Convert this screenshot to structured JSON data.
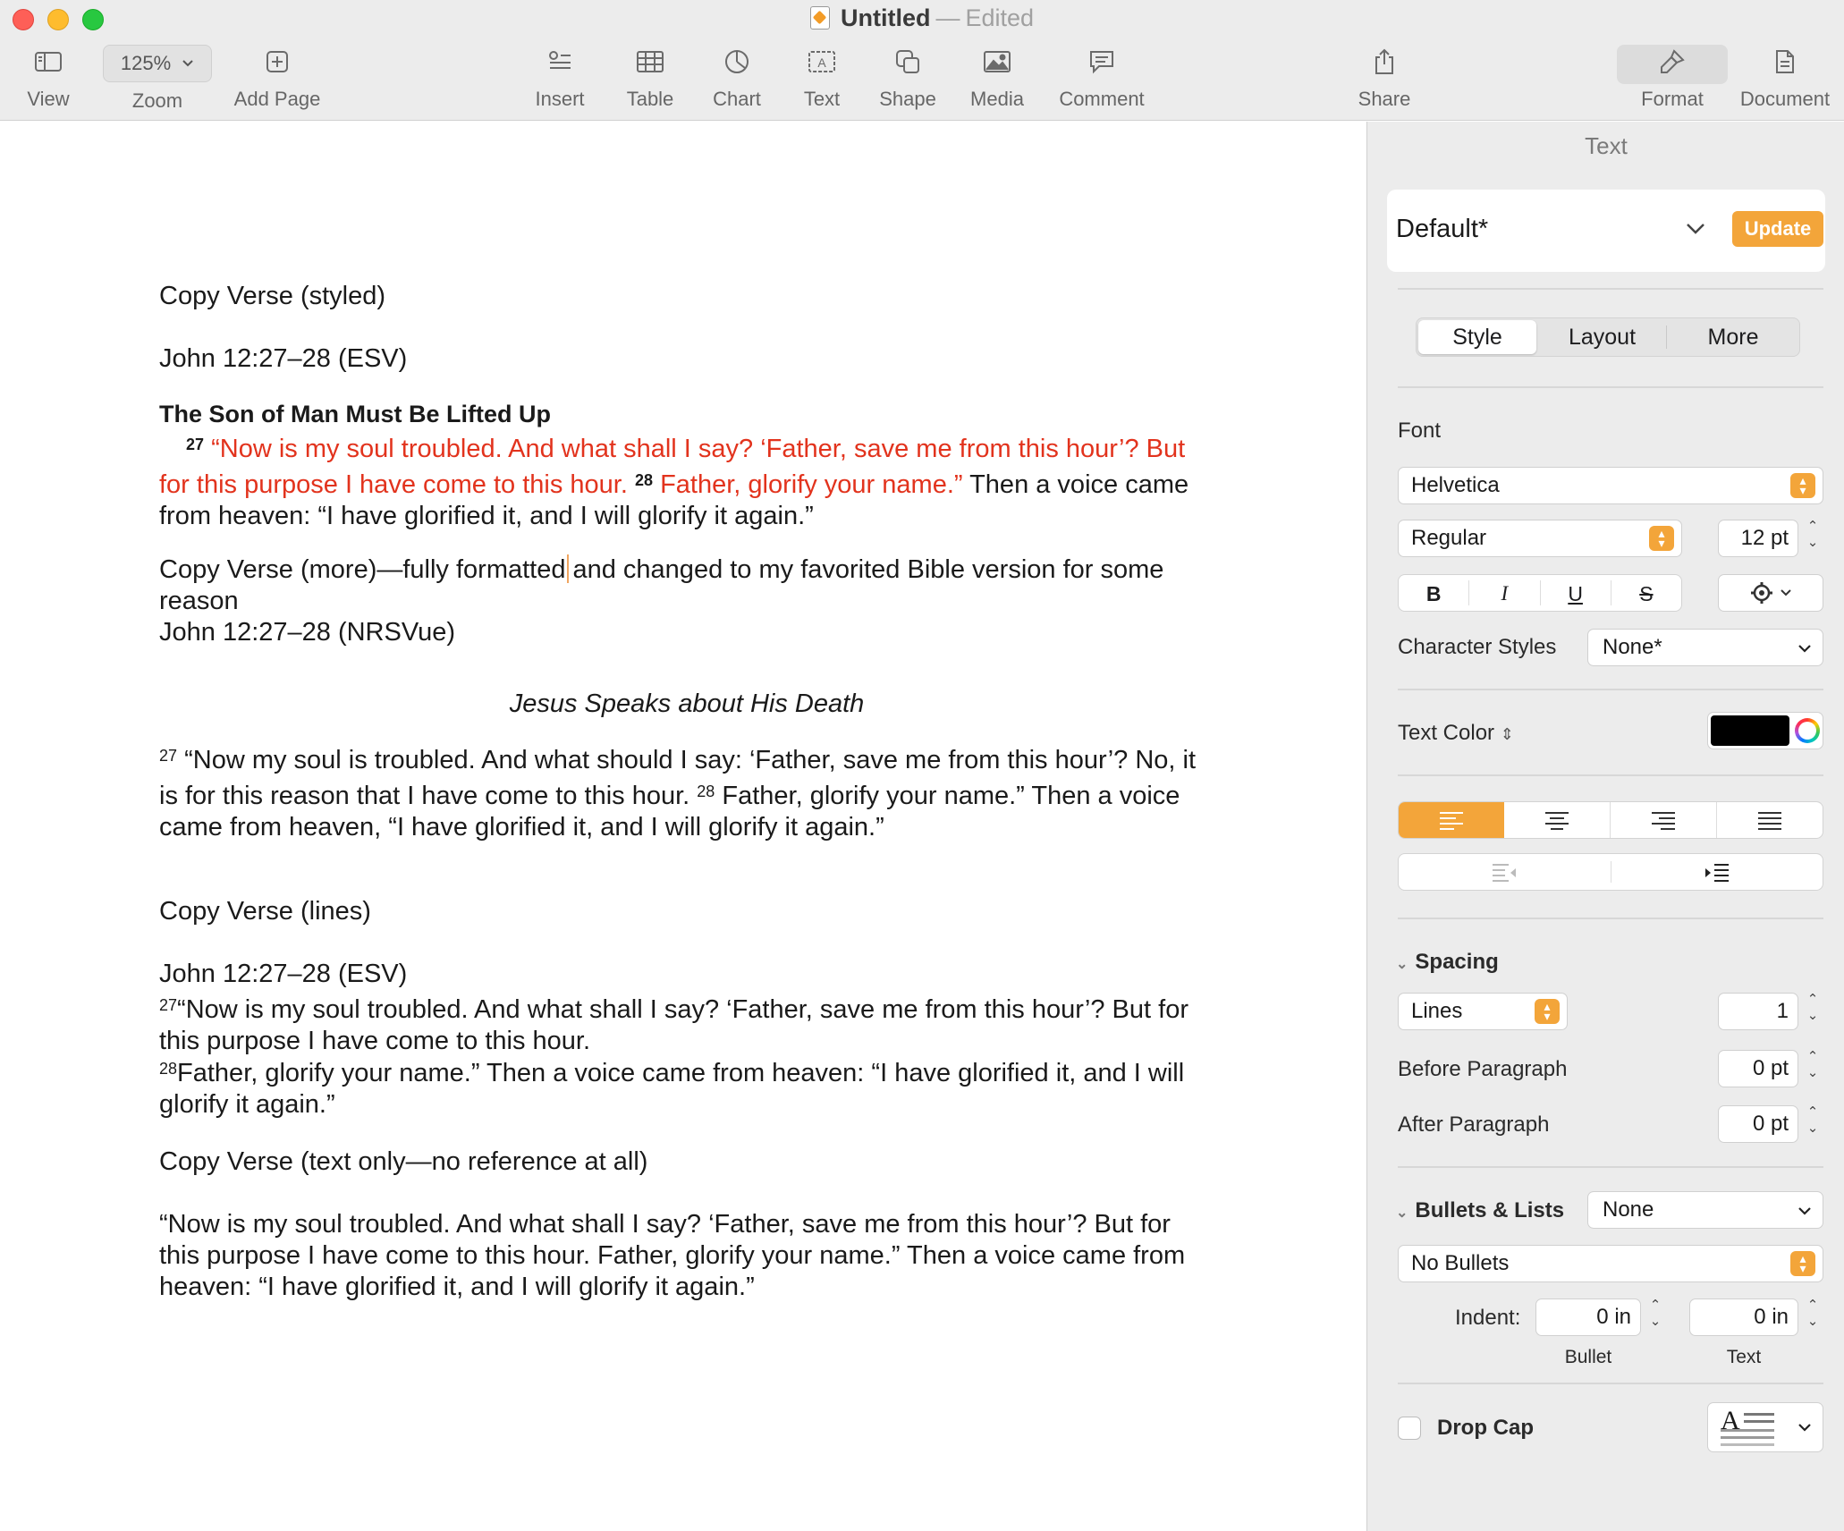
{
  "window": {
    "title": "Untitled",
    "separator": "—",
    "status": "Edited"
  },
  "toolbar": {
    "view": "View",
    "zoom_value": "125%",
    "zoom": "Zoom",
    "add_page": "Add Page",
    "insert": "Insert",
    "table": "Table",
    "chart": "Chart",
    "text": "Text",
    "shape": "Shape",
    "media": "Media",
    "comment": "Comment",
    "share": "Share",
    "format": "Format",
    "document": "Document"
  },
  "document": {
    "p1": "Copy Verse (styled)",
    "p2": "John 12:27–28 (ESV)",
    "p3_heading": "The Son of Man Must Be Lifted Up",
    "p4_sup27": "27",
    "p4_red1": "“Now is my soul troubled. And what shall I say? ‘Father, save me from this hour’? But for this purpose I have come to this hour.",
    "p4_sup28": "28",
    "p4_red2": "Father, glorify your name.”",
    "p4_black": "Then a voice came from heaven: “I have glorified it, and I will glorify it again.”",
    "p5_before_caret": "Copy Verse (more)—fully formatted",
    "p5_after_caret": "and changed to my favorited Bible version for some reason",
    "p6": "John 12:27–28 (NRSVue)",
    "p7_italic_heading": "Jesus Speaks about His Death",
    "p8_sup27": "27",
    "p8_text1": "“Now my soul is troubled. And what should I say: ‘Father, save me from this hour’? No, it is for this reason that I have come to this hour.",
    "p8_sup28": "28",
    "p8_text2": "Father, glorify your name.” Then a voice came from heaven, “I have glorified it, and I will glorify it again.”",
    "p9": "Copy Verse (lines)",
    "p10": "John 12:27–28 (ESV)",
    "p11_sup27": "27",
    "p11_text": "“Now is my soul troubled. And what shall I say? ‘Father, save me from this hour’? But for this purpose I have come to this hour.",
    "p12_sup28": "28",
    "p12_text": "Father, glorify your name.” Then a voice came from heaven: “I have glorified it, and I will glorify it again.”",
    "p13": "Copy Verse (text only—no reference at all)",
    "p14": "“Now is my soul troubled. And what shall I say? ‘Father, save me from this hour’? But for this purpose I have come to this hour. Father, glorify your name.” Then a voice came from heaven: “I have glorified it, and I will glorify it again.”"
  },
  "inspector": {
    "header": "Text",
    "paragraph_style": "Default*",
    "update_button": "Update",
    "tabs": [
      "Style",
      "Layout",
      "More"
    ],
    "active_tab": "Style",
    "font_label": "Font",
    "font_family": "Helvetica",
    "font_weight": "Regular",
    "font_size": "12 pt",
    "bold": "B",
    "italic": "I",
    "underline": "U",
    "strikethrough": "S",
    "character_styles_label": "Character Styles",
    "character_styles_value": "None*",
    "text_color_label": "Text Color",
    "text_color": "#000000",
    "alignment_active": "left",
    "spacing_label": "Spacing",
    "spacing_mode": "Lines",
    "spacing_value": "1",
    "before_paragraph_label": "Before Paragraph",
    "before_paragraph_value": "0 pt",
    "after_paragraph_label": "After Paragraph",
    "after_paragraph_value": "0 pt",
    "bullets_label": "Bullets & Lists",
    "bullets_value": "None",
    "bullet_type": "No Bullets",
    "indent_label": "Indent:",
    "bullet_indent": "0 in",
    "text_indent": "0 in",
    "bullet_caption": "Bullet",
    "text_caption": "Text",
    "drop_cap_label": "Drop Cap",
    "drop_cap_checked": false,
    "drop_cap_preview": "A"
  },
  "colors": {
    "accent": "#f3a53a",
    "verse_red": "#e2331d"
  }
}
